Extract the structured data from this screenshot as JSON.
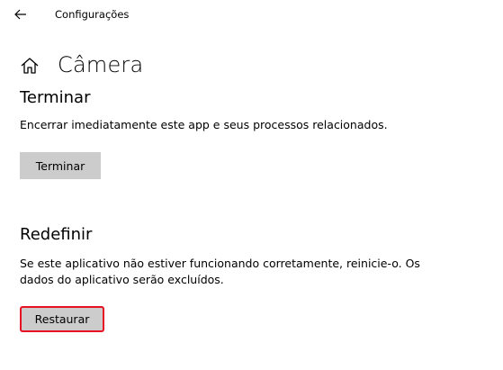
{
  "window": {
    "app_title": "Configurações"
  },
  "page": {
    "title": "Câmera"
  },
  "sections": {
    "terminate": {
      "heading": "Terminar",
      "description": "Encerrar imediatamente este app e seus processos relacionados.",
      "button_label": "Terminar"
    },
    "reset": {
      "heading": "Redefinir",
      "description_line1": "Se este aplicativo não estiver funcionando corretamente, reinicie-o. Os",
      "description_line2": "dados do aplicativo serão excluídos.",
      "button_label": "Restaurar"
    }
  },
  "icons": {
    "back": "back-arrow-icon",
    "home": "home-icon"
  },
  "colors": {
    "button_bg": "#cccccc",
    "highlight": "#e81123"
  }
}
